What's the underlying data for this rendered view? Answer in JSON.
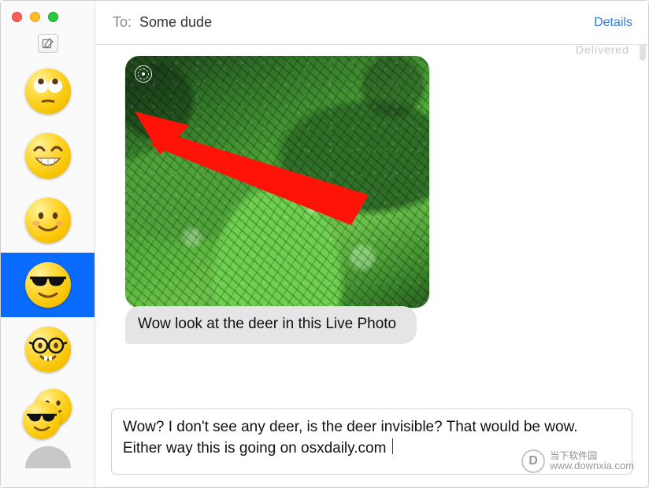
{
  "window": {
    "traffic": {
      "close": "close",
      "min": "minimize",
      "max": "maximize"
    }
  },
  "sidebar": {
    "compose_tooltip": "Compose",
    "items": [
      {
        "id": "conv-eyeroll",
        "emoji": "eyeroll",
        "selected": false
      },
      {
        "id": "conv-grin",
        "emoji": "grin",
        "selected": false
      },
      {
        "id": "conv-smile",
        "emoji": "smile",
        "selected": false
      },
      {
        "id": "conv-cool",
        "emoji": "cool",
        "selected": true
      },
      {
        "id": "conv-nerd",
        "emoji": "nerd",
        "selected": false
      },
      {
        "id": "conv-double",
        "emoji": "smirk+cool",
        "selected": false
      },
      {
        "id": "conv-gray",
        "emoji": "avatar-placeholder",
        "selected": false
      }
    ]
  },
  "header": {
    "to_label": "To:",
    "recipient": "Some dude",
    "details_label": "Details"
  },
  "chat": {
    "delivery_status": "Delivered",
    "photo": {
      "alt": "green foliage",
      "live_photo": true,
      "annotation_arrow": {
        "color": "#ff1208",
        "points_to": "live-photo-badge-top-left"
      }
    },
    "incoming_message": "Wow look at the deer in this Live Photo"
  },
  "composer": {
    "draft_text": "Wow? I don't see any deer, is the deer invisible? That would be wow. Either way this is going on osxdaily.com "
  },
  "watermark": {
    "cn": "当下软件园",
    "url": "www.downxia.com",
    "logo_letter": "D"
  }
}
